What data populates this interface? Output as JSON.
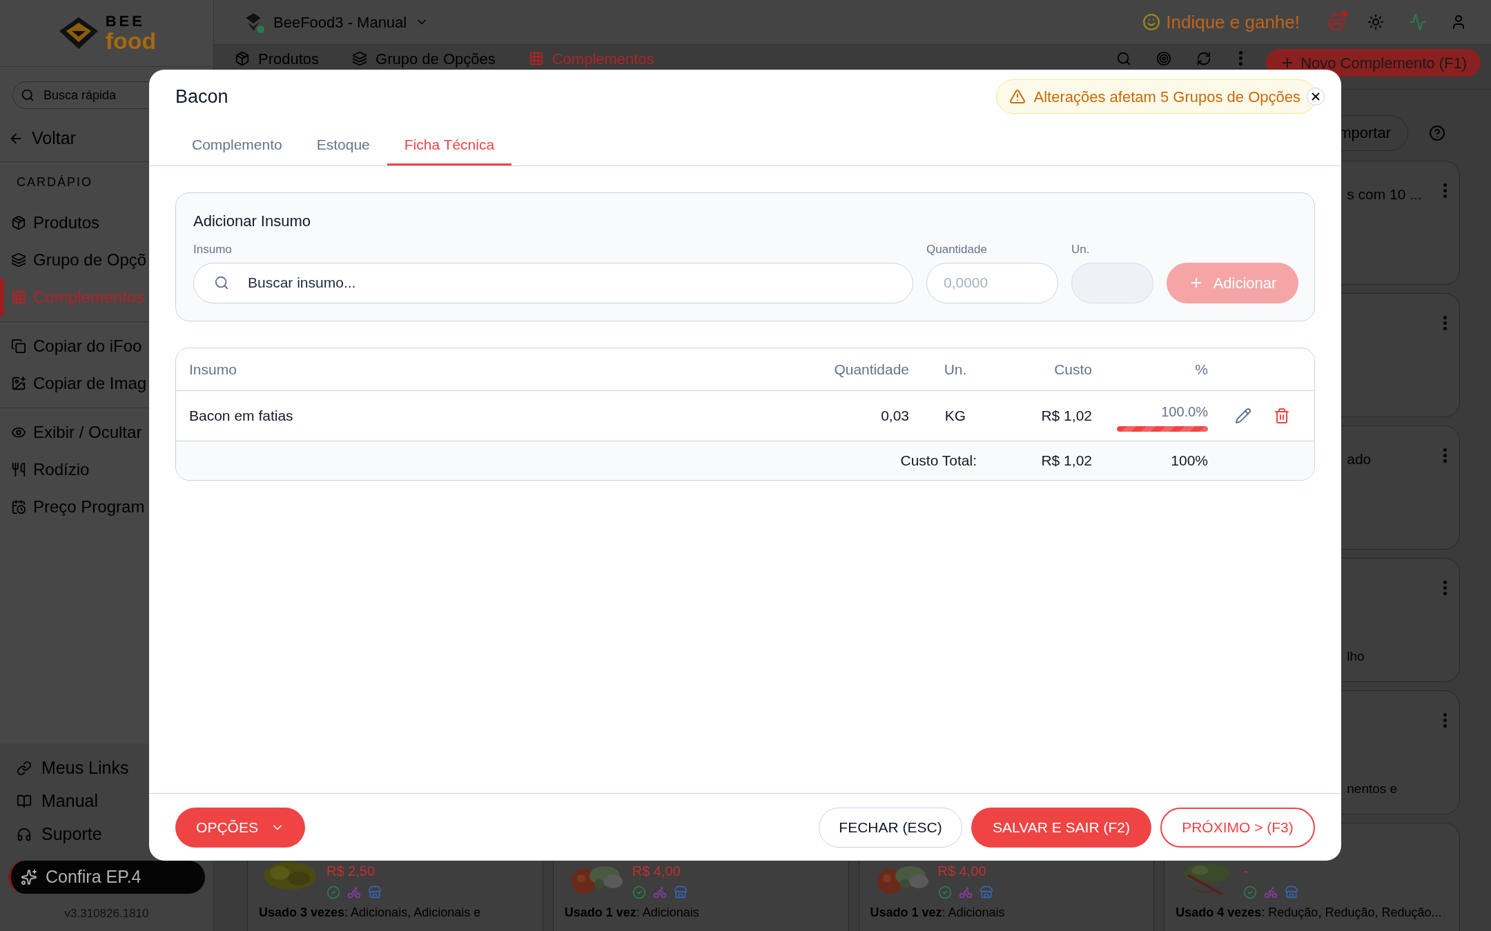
{
  "app": {
    "logo": {
      "top": "BEE",
      "bottom": "food"
    },
    "store": "BeeFood3 - Manual",
    "referral": "Indique e ganhe!",
    "search": {
      "placeholder": "Busca rápida"
    },
    "back": "Voltar",
    "section": "CARDÁPIO",
    "sidebar_groups": [
      [
        {
          "label": "Produtos",
          "selected": false
        },
        {
          "label": "Grupo de Opçõ",
          "selected": false
        },
        {
          "label": "Complementos",
          "selected": true
        }
      ],
      [
        {
          "label": "Copiar do iFoo",
          "selected": false
        },
        {
          "label": "Copiar de Imag",
          "selected": false
        }
      ],
      [
        {
          "label": "Exibir / Ocultar",
          "selected": false
        },
        {
          "label": "Rodízio",
          "selected": false
        },
        {
          "label": "Preço Program",
          "selected": false
        }
      ]
    ],
    "sidebar_bottom": [
      {
        "label": "Meus Links"
      },
      {
        "label": "Manual"
      },
      {
        "label": "Suporte"
      }
    ],
    "promo": "Confira EP.4",
    "version": "v3.310826.1810",
    "page_tabs": [
      {
        "label": "Produtos",
        "selected": false
      },
      {
        "label": "Grupo de Opções",
        "selected": false
      },
      {
        "label": "Complementos",
        "selected": true
      }
    ],
    "new_button": "Novo Complemento (F1)",
    "import_button": "mportar",
    "side_cards": [
      {
        "kind": "card",
        "title": "s com 10 ..."
      },
      {
        "kind": "card"
      },
      {
        "kind": "card",
        "title": "ado"
      },
      {
        "kind": "card",
        "description": "lho"
      },
      {
        "kind": "card",
        "description": "nentos e"
      }
    ],
    "bottom_cards": [
      {
        "price": "R$ 2,50",
        "usage": "**Usado 3 vezes**: Adicionais, Adicionais e"
      },
      {
        "price": "R$ 4,00",
        "usage": "**Usado 1 vez**: Adicionais"
      },
      {
        "price": "R$ 4,00",
        "usage": "**Usado 1 vez**: Adicionais"
      },
      {
        "price": "-",
        "usage": "**Usado 4 vezes**: Redução, Redução, Redução..."
      }
    ]
  },
  "modal": {
    "title": "Bacon",
    "warning": "Alterações afetam 5 Grupos de Opções",
    "tabs": [
      {
        "label": "Complemento",
        "selected": false
      },
      {
        "label": "Estoque",
        "selected": false
      },
      {
        "label": "Ficha Técnica",
        "selected": true
      }
    ],
    "add_section": {
      "title": "Adicionar Insumo",
      "fields": [
        {
          "label": "Insumo",
          "placeholder": "Buscar insumo..."
        },
        {
          "label": "Quantidade",
          "placeholder": "0,0000"
        },
        {
          "label": "Un."
        }
      ],
      "add_button": {
        "label": "Adicionar",
        "disabled": true
      }
    },
    "table": {
      "columns": [
        "Insumo",
        "Quantidade",
        "Un.",
        "Custo",
        "%"
      ],
      "rows": [
        {
          "insumo": "Bacon em fatias",
          "quantidade": "0,03",
          "un": "KG",
          "custo": "R$ 1,02",
          "percent": "100.0%",
          "level": 1
        }
      ],
      "total": {
        "label": "Custo Total:",
        "custo": "R$ 1,02",
        "percent": "100%"
      }
    },
    "footer": {
      "options": "OPÇÕES",
      "close": "FECHAR (ESC)",
      "save": "SALVAR E SAIR (F2)",
      "next": "PRÓXIMO > (F3)"
    }
  }
}
